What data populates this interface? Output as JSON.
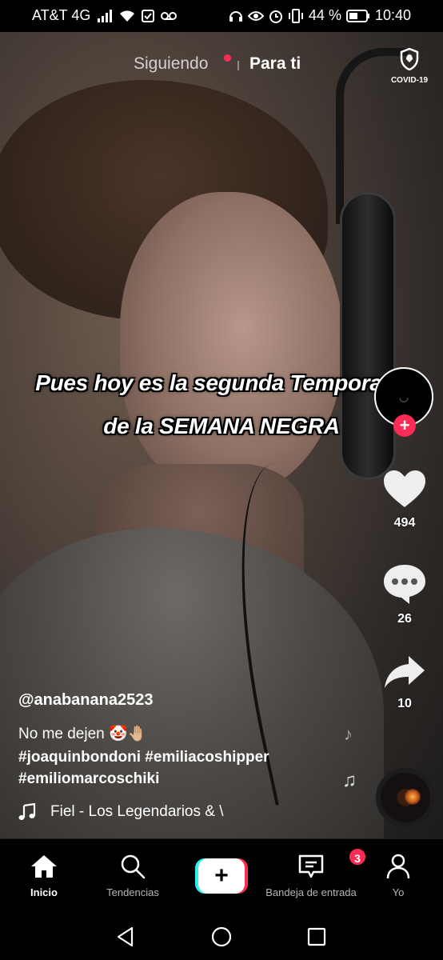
{
  "status_bar": {
    "carrier": "AT&T 4G",
    "battery_percent": "44 %",
    "time": "10:40",
    "icons": [
      "signal-icon",
      "wifi-icon",
      "message-icon",
      "voicemail-icon",
      "headset-icon",
      "eye-icon",
      "alarm-icon",
      "vibrate-icon",
      "battery-icon"
    ]
  },
  "top_nav": {
    "following_label": "Siguiendo",
    "for_you_label": "Para ti",
    "covid_label": "COVID-19"
  },
  "video": {
    "caption_line1": "Pues hoy es la segunda Temporada",
    "caption_line2": "de la SEMANA NEGRA"
  },
  "rail": {
    "likes": "494",
    "comments": "26",
    "shares": "10",
    "follow_symbol": "+"
  },
  "post": {
    "username": "@anabanana2523",
    "description": "No me dejen 🤡🤚🏼",
    "hashtags_line1": "#joaquinbondoni #emiliacoshipper",
    "hashtags_line2": "#emiliomarcoschiki",
    "music": "Fiel - Los Legendarios & \\"
  },
  "bottom_nav": {
    "home": "Inicio",
    "trending": "Tendencias",
    "create_symbol": "+",
    "inbox": "Bandeja de entrada",
    "inbox_badge": "3",
    "me": "Yo"
  },
  "colors": {
    "accent_red": "#fe2c55",
    "accent_cyan": "#25f4ee",
    "background": "#000000"
  }
}
